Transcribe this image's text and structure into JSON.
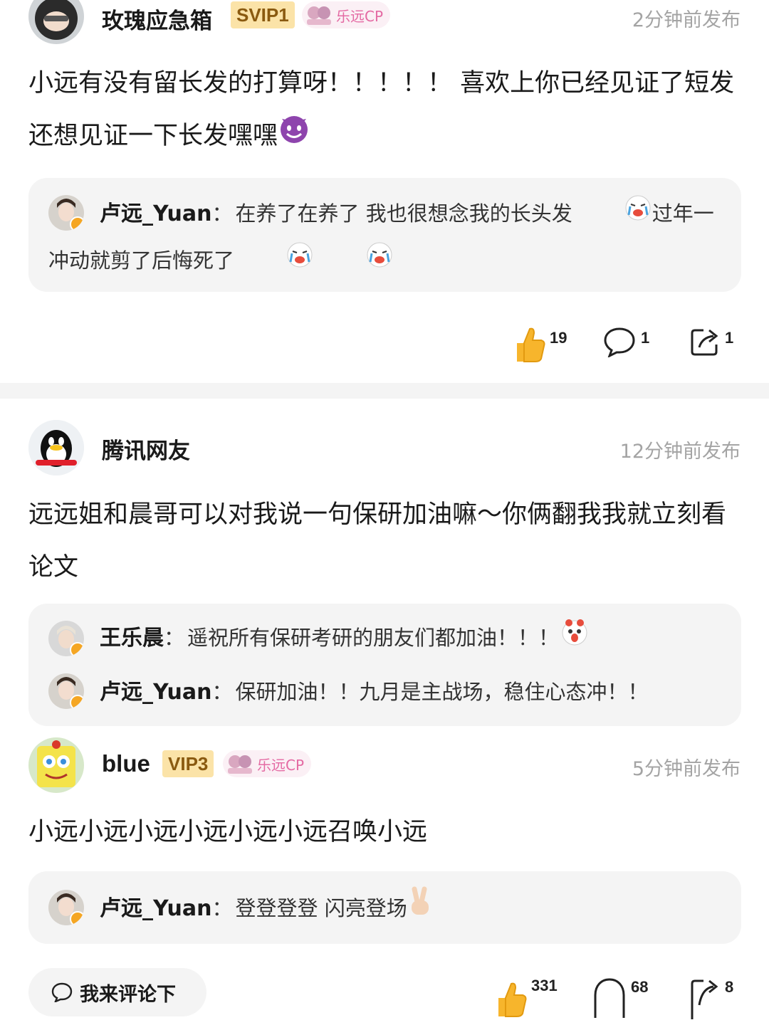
{
  "comments": [
    {
      "username": "玫瑰应急箱",
      "vip": "SVIP1",
      "cp_label": "乐远CP",
      "time": "2分钟前发布",
      "text": "小远有没有留长发的打算呀！！！！！ 喜欢上你已经见证了短发 还想见证一下长发嘿嘿",
      "replies": [
        {
          "name": "卢远_Yuan",
          "text_a": "在养了在养了 我也很想念我的长头发",
          "text_b": "过年一冲动就剪了后悔死了"
        }
      ],
      "likes": "19",
      "comments_count": "1",
      "shares": "1"
    },
    {
      "username": "腾讯网友",
      "time": "12分钟前发布",
      "text": "远远姐和晨哥可以对我说一句保研加油嘛～你俩翻我我就立刻看论文",
      "replies": [
        {
          "name": "王乐晨",
          "text": "遥祝所有保研考研的朋友们都加油！！！"
        },
        {
          "name": "卢远_Yuan",
          "text": "保研加油！！九月是主战场，稳住心态冲！！"
        }
      ]
    },
    {
      "username": "blue",
      "vip": "VIP3",
      "cp_label": "乐远CP",
      "time": "5分钟前发布",
      "text": "小远小远小远小远小远小远召唤小远",
      "replies": [
        {
          "name": "卢远_Yuan",
          "text": "登登登登 闪亮登场"
        }
      ]
    }
  ],
  "footer": {
    "comment_button_label": "我来评论下",
    "likes": "331",
    "comments_count": "68",
    "shares": "8"
  },
  "colors": {
    "vip_bg": "#fbe3a8",
    "vip_text": "#8a5a10",
    "cp_text": "#e46aa3",
    "reply_bg": "#f4f4f4",
    "time_text": "#a4a4a4",
    "like_yellow": "#f7b52c"
  }
}
